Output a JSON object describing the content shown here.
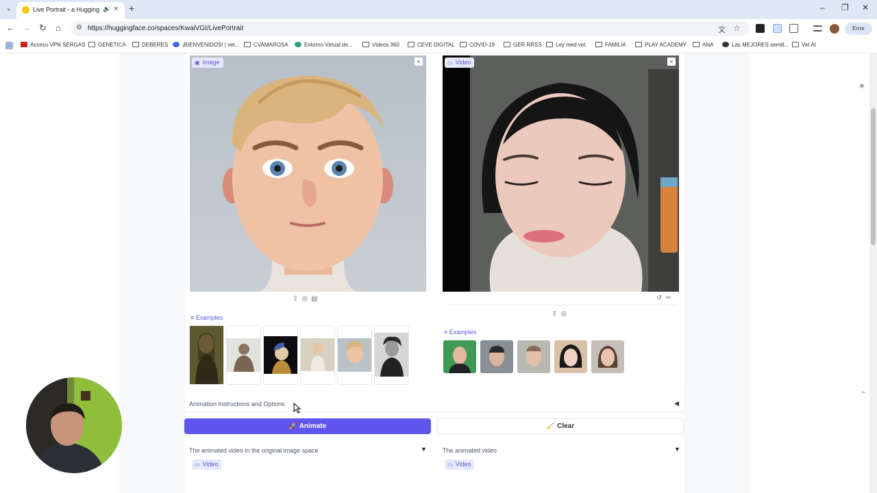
{
  "browser": {
    "tab_title": "Live Portrait - a Hugging Face",
    "url": "https://huggingface.co/spaces/KwaiVGI/LivePortrait",
    "profile_status": "Error"
  },
  "bookmarks": [
    "Acceso VPN SERGAS",
    "GENETICA",
    "DEBERES",
    "¡BIENVENIDOS! | vet...",
    "CVAMAROSA",
    "Entorno Virtual de...",
    "Videos 360",
    "CEVE DIGITAL",
    "COVID-19",
    "GER RRSS",
    "Ley med vet",
    "FAMILIA",
    "PLAY ACADEMY",
    "ANA",
    "Las MEJORES semill...",
    "Vet AI"
  ],
  "source_image": {
    "chip_label": "Image",
    "examples_label": "Examples"
  },
  "driving_video": {
    "chip_label": "Video",
    "examples_label": "Examples"
  },
  "options": {
    "accordion_label": "Animation Instructions and Options"
  },
  "actions": {
    "animate_label": "Animate",
    "clear_label": "Clear"
  },
  "outputs": {
    "left_label": "The animated video in the original image space",
    "right_label": "The animated video",
    "left_chip": "Video",
    "right_chip": "Video"
  }
}
